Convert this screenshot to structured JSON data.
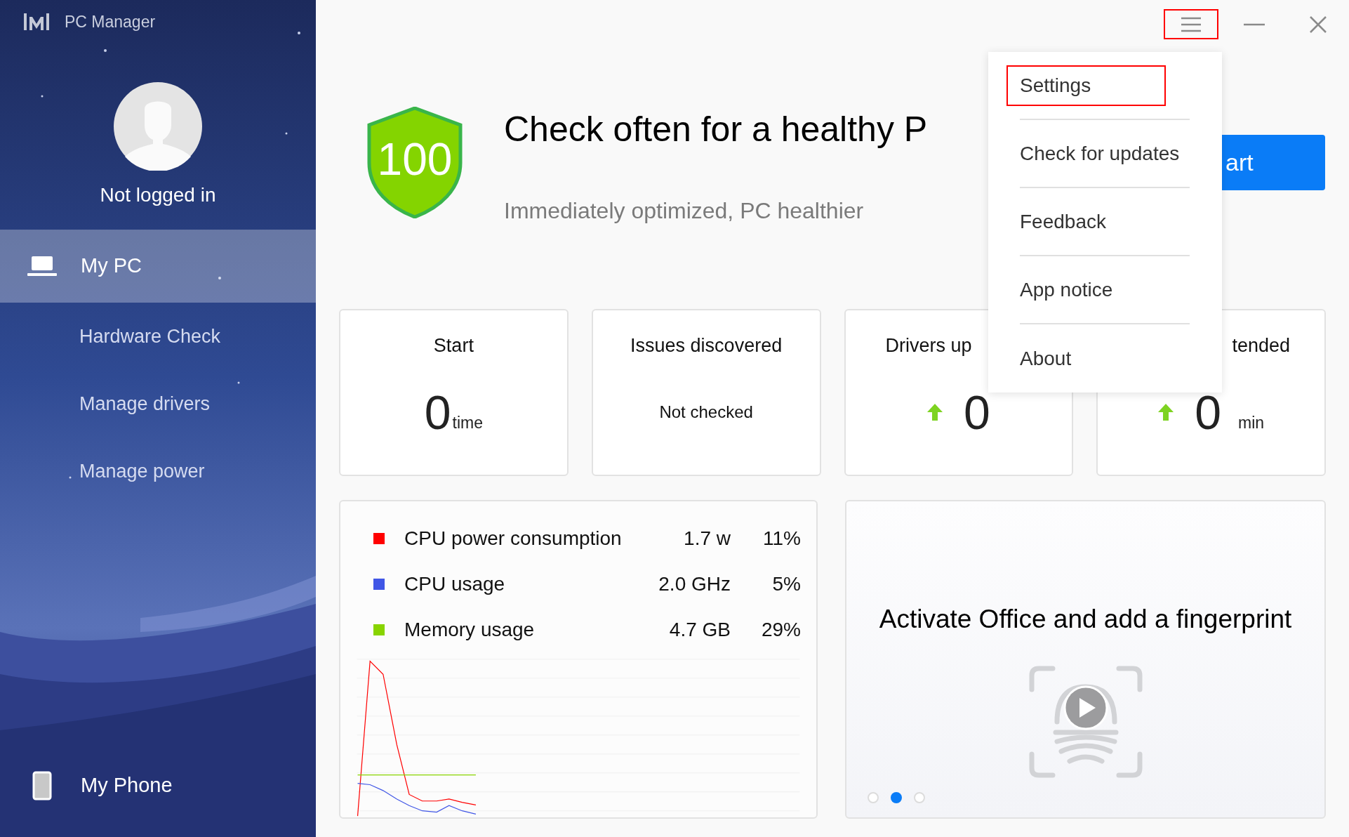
{
  "app": {
    "title": "PC Manager"
  },
  "user": {
    "status": "Not logged in"
  },
  "sidebar": {
    "items": [
      {
        "kind": "laptop",
        "label": "My PC",
        "selected": true
      },
      {
        "kind": "page",
        "label": "Hardware Check",
        "selected": false
      },
      {
        "kind": "page",
        "label": "Manage drivers",
        "selected": false
      },
      {
        "kind": "page",
        "label": "Manage power",
        "selected": false
      },
      {
        "kind": "phone",
        "label": "My Phone",
        "selected": false
      }
    ]
  },
  "window_controls": {
    "menu_highlighted": true
  },
  "hero": {
    "score": "100",
    "title": "Check often for a healthy P",
    "subtitle": "Immediately optimized, PC healthier",
    "button": "art"
  },
  "stats": [
    {
      "kind": "number",
      "title": "Start",
      "cut_right": false,
      "cut_left": false,
      "arrow": false,
      "value": "0",
      "unit": "time"
    },
    {
      "kind": "text",
      "title": "Issues discovered",
      "cut_right": false,
      "cut_left": false,
      "value": "Not checked"
    },
    {
      "kind": "number",
      "title": "Drivers up",
      "cut_right": true,
      "cut_left": false,
      "arrow": true,
      "value": "0"
    },
    {
      "kind": "number",
      "title": "tended",
      "cut_right": false,
      "cut_left": true,
      "arrow": true,
      "value": "0",
      "unit": "min"
    }
  ],
  "usage": {
    "rows": [
      {
        "label": "CPU power consumption",
        "value": "1.7 w",
        "percent": "11%",
        "color": "#ff0000"
      },
      {
        "label": "CPU usage",
        "value": "2.0 GHz",
        "percent": "5%",
        "color": "#4056e6"
      },
      {
        "label": "Memory usage",
        "value": "4.7 GB",
        "percent": "29%",
        "color": "#88d400"
      }
    ]
  },
  "promo": {
    "title": "Activate Office and add a fingerprint",
    "pages": [
      {
        "selected": false
      },
      {
        "selected": true
      },
      {
        "selected": false
      }
    ]
  },
  "menu": {
    "items": [
      {
        "label": "Settings",
        "highlighted": true
      },
      {
        "label": "Check for updates",
        "highlighted": false
      },
      {
        "label": "Feedback",
        "highlighted": false
      },
      {
        "label": "App notice",
        "highlighted": false
      },
      {
        "label": "About",
        "highlighted": false
      }
    ]
  }
}
